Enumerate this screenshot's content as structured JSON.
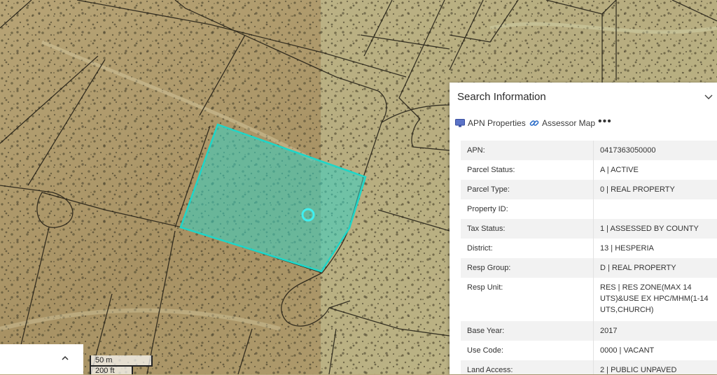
{
  "map": {
    "selected_parcel_color": "#34d3c7",
    "marker_color": "#33e6e6"
  },
  "panel": {
    "title": "Search Information",
    "toolbar": {
      "apn_properties_label": "APN Properties",
      "assessor_map_label": "Assessor Map",
      "more_label": "•••"
    },
    "rows": [
      {
        "key": "APN:",
        "value": "0417363050000"
      },
      {
        "key": "Parcel Status:",
        "value": "A | ACTIVE"
      },
      {
        "key": "Parcel Type:",
        "value": "0 | REAL PROPERTY"
      },
      {
        "key": "Property ID:",
        "value": ""
      },
      {
        "key": "Tax Status:",
        "value": "1 | ASSESSED BY COUNTY"
      },
      {
        "key": "District:",
        "value": "13 | HESPERIA"
      },
      {
        "key": "Resp Group:",
        "value": "D | REAL PROPERTY"
      },
      {
        "key": "Resp Unit:",
        "value": "RES | RES ZONE(MAX 14 UTS)&USE EX HPC/MHM(1-14 UTS,CHURCH)"
      },
      {
        "key": "Base Year:",
        "value": "2017"
      },
      {
        "key": "Use Code:",
        "value": "0000 | VACANT"
      },
      {
        "key": "Land Access:",
        "value": "2 | PUBLIC UNPAVED"
      }
    ]
  },
  "scale": {
    "metric_label": "50 m",
    "imperial_label": "200 ft"
  },
  "icons": {
    "collapse": "chevron-down-icon",
    "apn_properties": "monitor-icon",
    "assessor_map": "link-icon",
    "expand": "chevron-up-icon"
  }
}
